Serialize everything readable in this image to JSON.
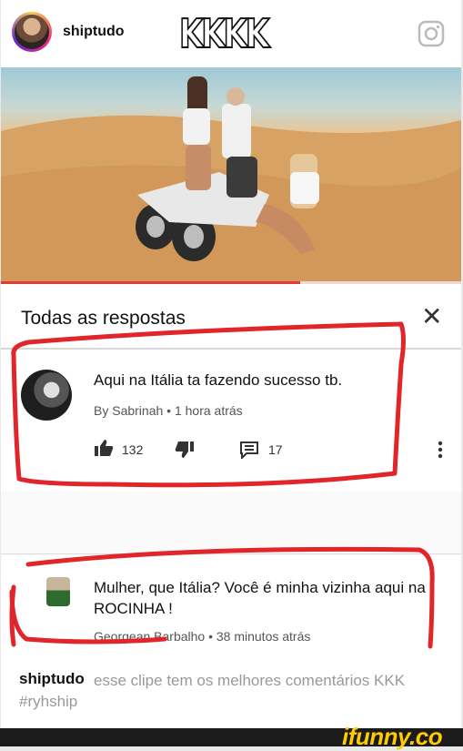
{
  "header": {
    "username": "shiptudo",
    "overlay_text": "KKKK",
    "avatar_icon": "profile-avatar",
    "camera_icon": "instagram-icon"
  },
  "video": {
    "progress": 0.65,
    "progress_color": "#e53935"
  },
  "thread": {
    "title": "Todas as respostas",
    "close_glyph": "✕"
  },
  "comments": [
    {
      "text": "Aqui na Itália ta fazendo sucesso tb.",
      "meta": "By Sabrinah • 1 hora atrás",
      "likes": "132",
      "replies": "17"
    },
    {
      "text": "Mulher, que Itália? Você é minha vizinha aqui na ROCINHA !",
      "meta": "Georgean Barbalho • 38 minutos atrás"
    }
  ],
  "footer": {
    "username": "shiptudo",
    "caption": "esse clipe tem os melhores comentários KKK #ryhship"
  },
  "watermark": "ifunny.co",
  "colors": {
    "annotation_red": "#e0262b",
    "watermark": "#ffcc00"
  }
}
